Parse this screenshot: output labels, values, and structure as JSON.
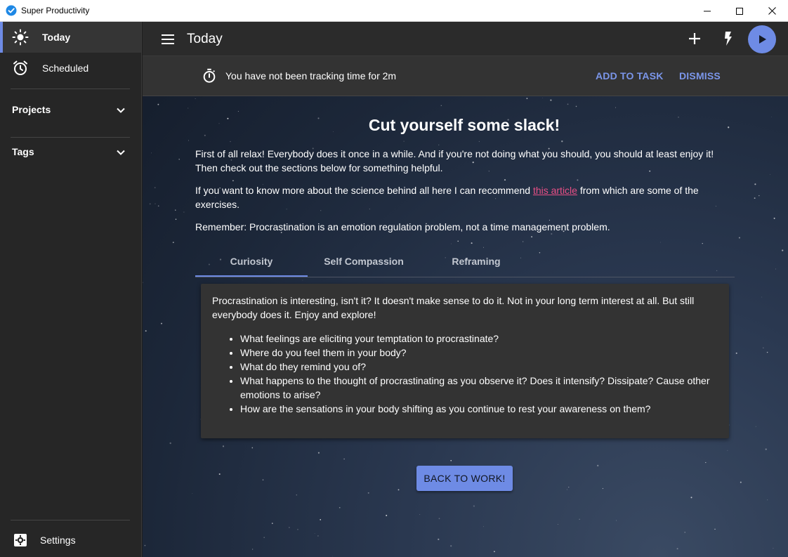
{
  "window": {
    "title": "Super Productivity"
  },
  "sidebar": {
    "items": [
      {
        "label": "Today",
        "icon": "sun-icon",
        "active": true
      },
      {
        "label": "Scheduled",
        "icon": "alarm-icon",
        "active": false
      }
    ],
    "sections": [
      {
        "label": "Projects"
      },
      {
        "label": "Tags"
      }
    ],
    "settings_label": "Settings"
  },
  "header": {
    "title": "Today"
  },
  "banner": {
    "message": "You have not been tracking time for 2m",
    "add_label": "ADD TO TASK",
    "dismiss_label": "DISMISS"
  },
  "content": {
    "heading": "Cut yourself some slack!",
    "p1": "First of all relax! Everybody does it once in a while. And if you're not doing what you should, you should at least enjoy it! Then check out the sections below for something helpful.",
    "p2_before": "If you want to know more about the science behind all here I can recommend ",
    "p2_link": "this article",
    "p2_after": " from which are some of the exercises.",
    "p3": "Remember: Procrastination is an emotion regulation problem, not a time management problem.",
    "tabs": [
      {
        "label": "Curiosity",
        "active": true
      },
      {
        "label": "Self Compassion",
        "active": false
      },
      {
        "label": "Reframing",
        "active": false
      }
    ],
    "card": {
      "intro": "Procrastination is interesting, isn't it? It doesn't make sense to do it. Not in your long term interest at all. But still everybody does it. Enjoy and explore!",
      "bullets": [
        "What feelings are eliciting your temptation to procrastinate?",
        "Where do you feel them in your body?",
        "What do they remind you of?",
        "What happens to the thought of procrastinating as you observe it? Does it intensify? Dissipate? Cause other emotions to arise?",
        "How are the sensations in your body shifting as you continue to rest your awareness on them?"
      ]
    },
    "back_label": "BACK TO WORK!"
  },
  "colors": {
    "accent": "#6e8be5",
    "link": "#e94f86",
    "sidebar": "#262626",
    "header": "#2b2b2b"
  }
}
